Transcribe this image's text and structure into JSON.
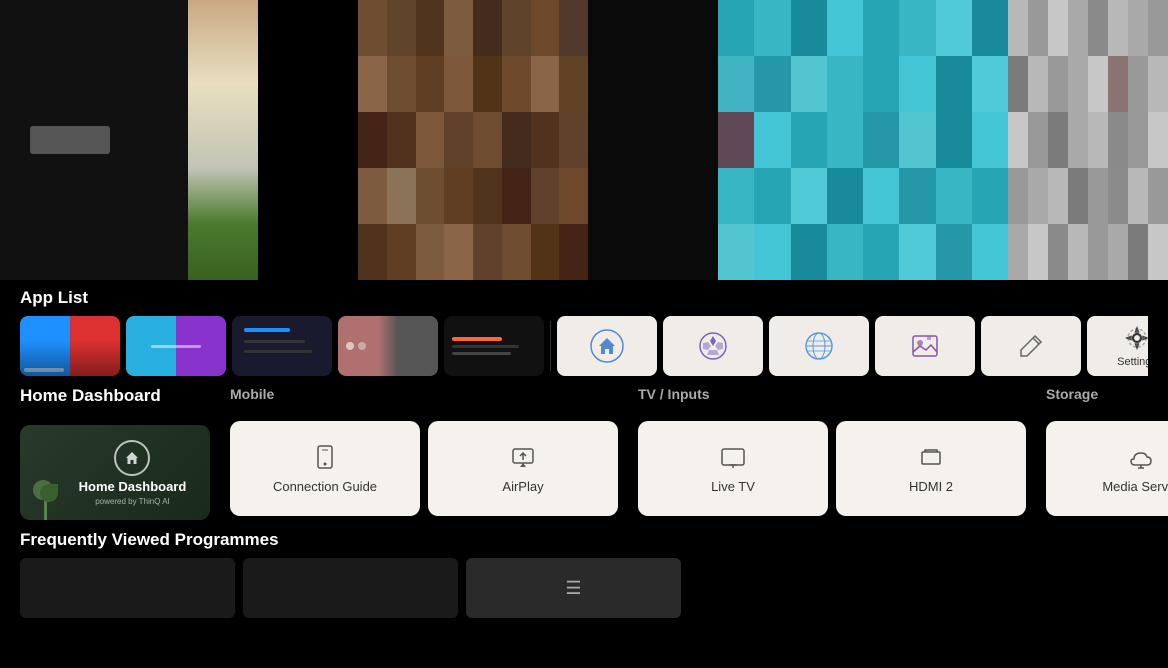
{
  "top": {
    "thumbnails": [
      {
        "id": "thumb1",
        "type": "portrait",
        "colors": [
          "#c9a882",
          "#e8dfc0",
          "#c2c4b4",
          "#4a7a2c"
        ]
      },
      {
        "id": "thumb2",
        "type": "landscape-brown",
        "colors": [
          "#6b4c35",
          "#8b6043",
          "#4a3020"
        ]
      },
      {
        "id": "thumb3",
        "type": "teal",
        "colors": [
          "#2ab8c8",
          "#3ecad8",
          "#1a9aaa"
        ]
      },
      {
        "id": "thumb4",
        "type": "gray-grid",
        "colors": [
          "#ccc",
          "#aaa",
          "#ddd"
        ]
      }
    ]
  },
  "app_list": {
    "title": "App List",
    "apps": [
      {
        "id": "app1",
        "label": "",
        "type": "colored"
      },
      {
        "id": "app2",
        "label": "",
        "type": "colored2"
      },
      {
        "id": "app3",
        "label": "",
        "type": "lines"
      },
      {
        "id": "app4",
        "label": "",
        "type": "colored3"
      },
      {
        "id": "app5",
        "label": "",
        "type": "lines2"
      },
      {
        "id": "app6",
        "label": "",
        "type": "icon-home"
      },
      {
        "id": "app7",
        "label": "",
        "type": "icon-sports"
      },
      {
        "id": "app8",
        "label": "",
        "type": "icon-globe"
      },
      {
        "id": "app9",
        "label": "",
        "type": "icon-gallery"
      },
      {
        "id": "app10",
        "label": "",
        "type": "icon-edit"
      },
      {
        "id": "app11",
        "label": "Settings",
        "type": "settings"
      }
    ]
  },
  "home_dashboard": {
    "section_title": "Home Dashboard",
    "card_label": "Home Dashboard",
    "subtitle": "powered by ThinQ AI"
  },
  "mobile": {
    "section_title": "Mobile",
    "cards": [
      {
        "id": "connection-guide",
        "label": "Connection Guide",
        "icon": "📱"
      },
      {
        "id": "airplay",
        "label": "AirPlay",
        "icon": "⬆"
      }
    ]
  },
  "tv_inputs": {
    "section_title": "TV / Inputs",
    "cards": [
      {
        "id": "live-tv",
        "label": "Live TV",
        "icon": "🖥"
      },
      {
        "id": "hdmi2",
        "label": "HDMI 2",
        "icon": "⬜"
      }
    ]
  },
  "storage": {
    "section_title": "Storage",
    "cards": [
      {
        "id": "media-server",
        "label": "Media Server",
        "icon": "☁"
      }
    ]
  },
  "frequently_viewed": {
    "title": "Frequently Viewed Programmes",
    "cards": [
      {
        "id": "fv1",
        "label": ""
      },
      {
        "id": "fv2",
        "label": ""
      },
      {
        "id": "fv3",
        "label": "☰"
      }
    ]
  }
}
